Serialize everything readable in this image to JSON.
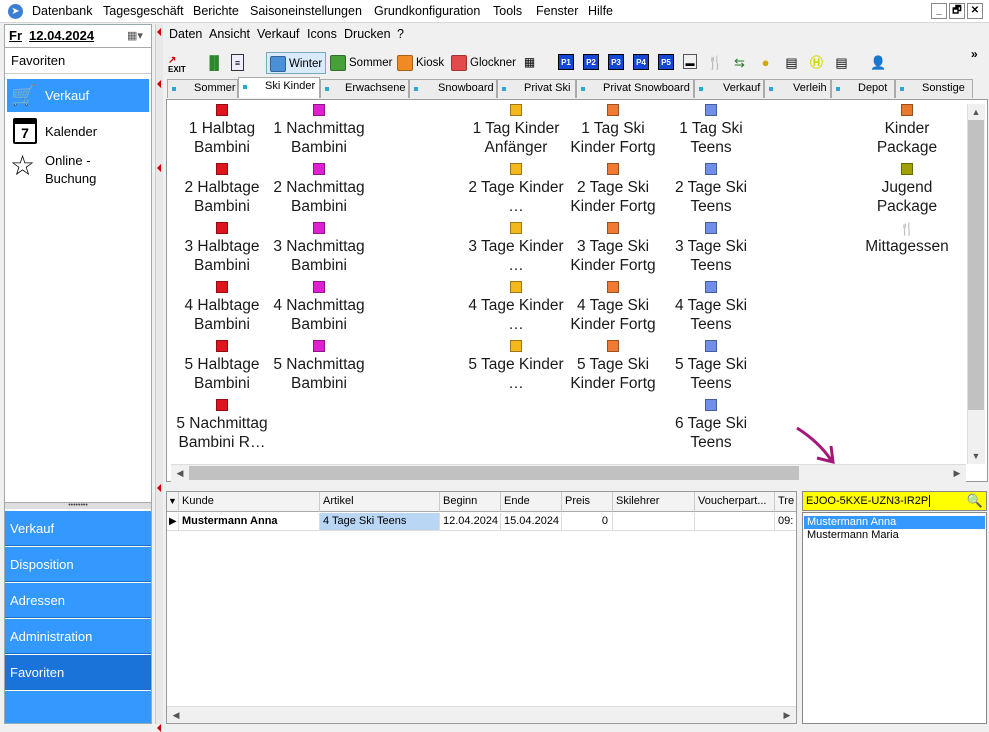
{
  "menubar": {
    "items": [
      "Datenbank",
      "Tagesgeschäft",
      "Berichte",
      "Saisoneinstellungen",
      "Grundkonfiguration",
      "Tools",
      "Fenster",
      "Hilfe"
    ],
    "controls": [
      "_",
      "🗗",
      "✕"
    ]
  },
  "date": {
    "day": "Fr",
    "value": "12.04.2024"
  },
  "left": {
    "favorites_title": "Favoriten",
    "top_items": [
      {
        "label": "Verkauf",
        "icon": "cart-icon"
      },
      {
        "label": "Kalender",
        "icon": "calendar-icon",
        "badge": "7"
      },
      {
        "label": "Online - Buchung",
        "icon": "star-icon"
      }
    ],
    "bottom_items": [
      "Verkauf",
      "Disposition",
      "Adressen",
      "Administration",
      "Favoriten"
    ]
  },
  "menu2": [
    "Daten",
    "Ansicht",
    "Verkauf",
    "Icons",
    "Drucken",
    "?"
  ],
  "toolbar": {
    "exit": "EXIT",
    "winter": "Winter",
    "sommer": "Sommer",
    "kiosk": "Kiosk",
    "glockner": "Glockner",
    "p_buttons": [
      "P1",
      "P2",
      "P3",
      "P4",
      "P5"
    ],
    "more": "»",
    "colors": {
      "winter": "#4a90d9",
      "sommer": "#46a03a",
      "kiosk": "#f08a24",
      "glockner": "#e24b4b"
    }
  },
  "tabs": [
    "Sommer",
    "Ski Kinder",
    "Erwachsene",
    "Snowboard",
    "Privat Ski",
    "Privat Snowboard",
    "Verkauf",
    "Verleih",
    "Depot",
    "Sonstige"
  ],
  "grid": {
    "col1": [
      "1 Halbtag Bambini",
      "2 Halbtage Bambini",
      "3 Halbtage Bambini",
      "4 Halbtage Bambini",
      "5 Halbtage Bambini",
      "5 Nachmittag Bambini R…"
    ],
    "col2": [
      "1 Nachmittag Bambini",
      "2 Nachmittag Bambini",
      "3 Nachmittag Bambini",
      "4 Nachmittag Bambini",
      "5 Nachmittag Bambini"
    ],
    "col3": [
      "1 Tag Kinder Anfänger",
      "2 Tage Kinder …",
      "3 Tage Kinder …",
      "4 Tage Kinder …",
      "5 Tage Kinder …"
    ],
    "col4": [
      "1 Tag Ski Kinder Fortg",
      "2 Tage Ski Kinder Fortg",
      "3 Tage Ski Kinder Fortg",
      "4 Tage Ski Kinder Fortg",
      "5 Tage Ski Kinder Fortg"
    ],
    "col5": [
      "1 Tag Ski Teens",
      "2 Tage Ski Teens",
      "3 Tage Ski Teens",
      "4 Tage Ski Teens",
      "5 Tage Ski Teens",
      "6 Tage Ski Teens"
    ],
    "col6": [
      "Kinder Package",
      "Jugend Package",
      "Mittagessen"
    ],
    "colors": [
      "#e0141e",
      "#e020d0",
      "#f2b81c",
      "#f07a32",
      "#6f8fe8",
      "#a0a000"
    ]
  },
  "table": {
    "headers": [
      "Kunde",
      "Artikel",
      "Beginn",
      "Ende",
      "Preis",
      "Skilehrer",
      "Voucherpart...",
      "Tre"
    ],
    "row": {
      "kunde": "Mustermann Anna",
      "artikel": "4 Tage Ski Teens",
      "beginn": "12.04.2024",
      "ende": "15.04.2024",
      "preis": "0",
      "tre": "09:"
    }
  },
  "search": {
    "value": "EJOO-5KXE-UZN3-IR2P",
    "results": [
      "Mustermann Anna",
      "Mustermann Maria"
    ]
  }
}
